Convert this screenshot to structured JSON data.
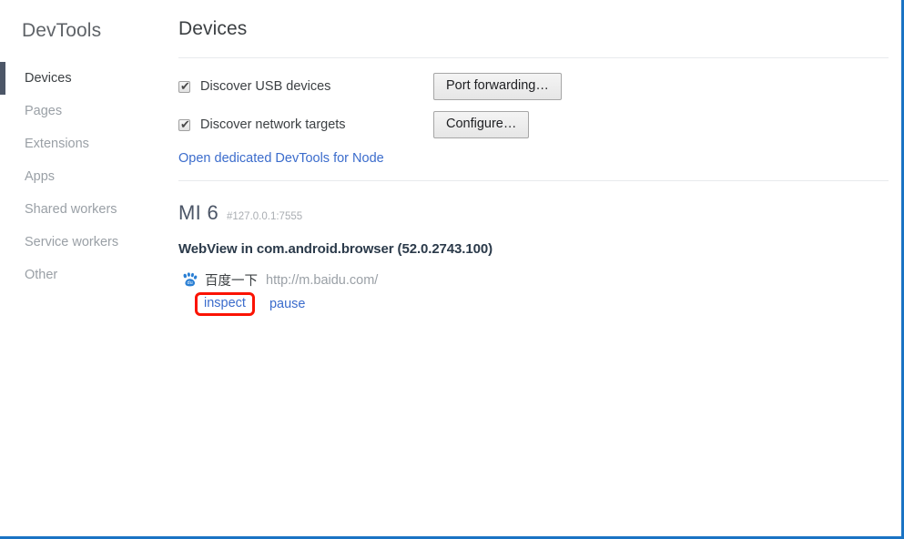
{
  "sidebar": {
    "title": "DevTools",
    "items": [
      {
        "label": "Devices",
        "selected": true
      },
      {
        "label": "Pages",
        "selected": false
      },
      {
        "label": "Extensions",
        "selected": false
      },
      {
        "label": "Apps",
        "selected": false
      },
      {
        "label": "Shared workers",
        "selected": false
      },
      {
        "label": "Service workers",
        "selected": false
      },
      {
        "label": "Other",
        "selected": false
      }
    ]
  },
  "main": {
    "page_title": "Devices",
    "discovery": {
      "usb": {
        "label": "Discover USB devices",
        "checked": true,
        "check_glyph": "✔",
        "button_label": "Port forwarding…"
      },
      "network": {
        "label": "Discover network targets",
        "checked": true,
        "check_glyph": "✔",
        "button_label": "Configure…"
      },
      "node_link_label": "Open dedicated DevTools for Node"
    },
    "device": {
      "name": "MI 6",
      "port": "#127.0.0.1:7555",
      "browser_title": "WebView in com.android.browser (52.0.2743.100)",
      "targets": [
        {
          "favicon": "baidu-paw-icon",
          "title": "百度一下",
          "url": "http://m.baidu.com/",
          "inspect_label": "inspect",
          "pause_label": "pause",
          "inspect_highlighted": true
        }
      ]
    }
  },
  "colors": {
    "frame_border": "#1a73c4",
    "link": "#3b6ccc",
    "highlight": "#fb1302",
    "selected_marker": "#4c5667",
    "muted_text": "#9aa0a6",
    "divider": "#e8eaed"
  }
}
